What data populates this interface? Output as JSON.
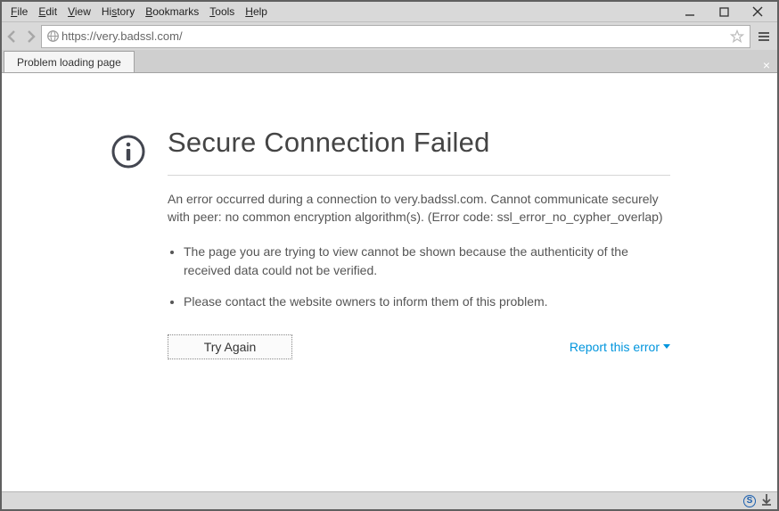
{
  "menubar": {
    "file": "File",
    "edit": "Edit",
    "view": "View",
    "history": "History",
    "bookmarks": "Bookmarks",
    "tools": "Tools",
    "help": "Help"
  },
  "url": "https://very.badssl.com/",
  "tab": {
    "title": "Problem loading page"
  },
  "error": {
    "title": "Secure Connection Failed",
    "description": "An error occurred during a connection to very.badssl.com. Cannot communicate securely with peer: no common encryption algorithm(s). (Error code: ssl_error_no_cypher_overlap)",
    "bullet1": "The page you are trying to view cannot be shown because the authenticity of the received data could not be verified.",
    "bullet2": "Please contact the website owners to inform them of this problem.",
    "try_again": "Try Again",
    "report": "Report this error"
  }
}
